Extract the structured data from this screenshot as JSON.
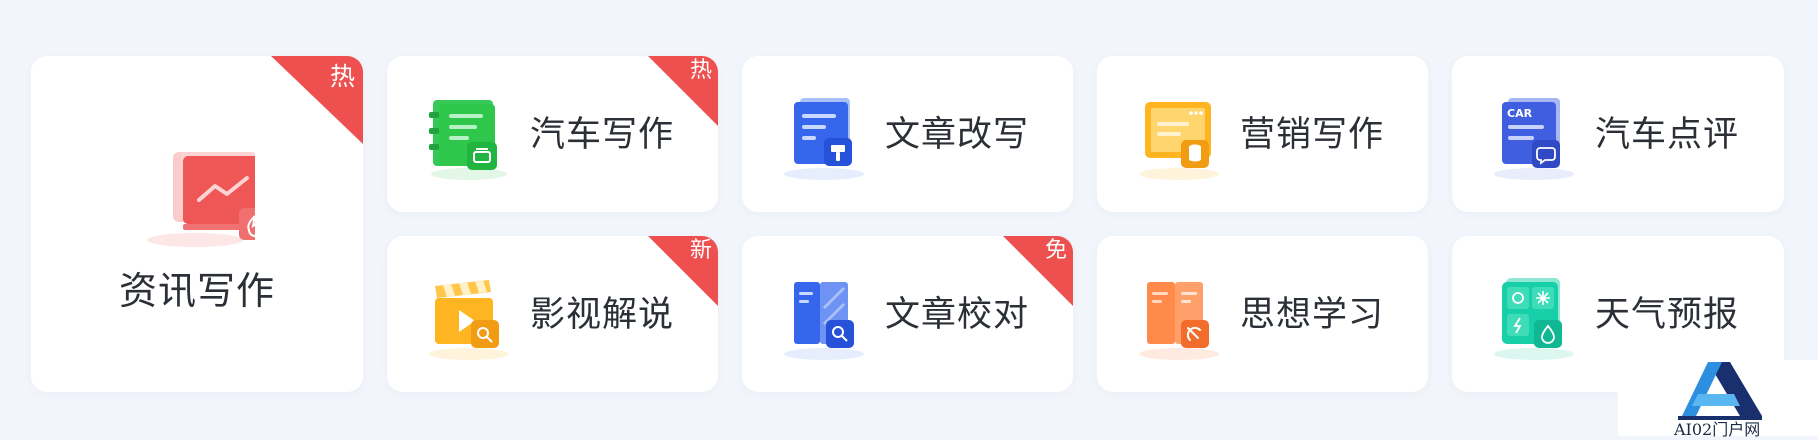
{
  "cards": [
    {
      "label": "资讯写作",
      "badge": "热",
      "icon": "monitor-chart-icon"
    },
    {
      "label": "汽车写作",
      "badge": "热",
      "icon": "car-notebook-icon"
    },
    {
      "label": "文章改写",
      "badge": "",
      "icon": "document-brush-icon"
    },
    {
      "label": "营销写作",
      "badge": "",
      "icon": "browser-database-icon"
    },
    {
      "label": "汽车点评",
      "badge": "",
      "icon": "car-comment-icon"
    },
    {
      "label": "影视解说",
      "badge": "新",
      "icon": "clapperboard-play-icon"
    },
    {
      "label": "文章校对",
      "badge": "免",
      "icon": "book-search-icon"
    },
    {
      "label": "思想学习",
      "badge": "",
      "icon": "book-party-icon"
    },
    {
      "label": "天气预报",
      "badge": "",
      "icon": "weather-grid-icon"
    }
  ],
  "icon_text": {
    "car": "CAR"
  },
  "watermark": {
    "text": "AI02门户网"
  },
  "colors": {
    "ribbon": "#ee5050",
    "red": "#ef5656",
    "green": "#2fc64c",
    "blue": "#3566ec",
    "yellow": "#ffb521",
    "indigo": "#3f5fe0",
    "orange": "#ff8a4a",
    "teal": "#17cfa8"
  }
}
